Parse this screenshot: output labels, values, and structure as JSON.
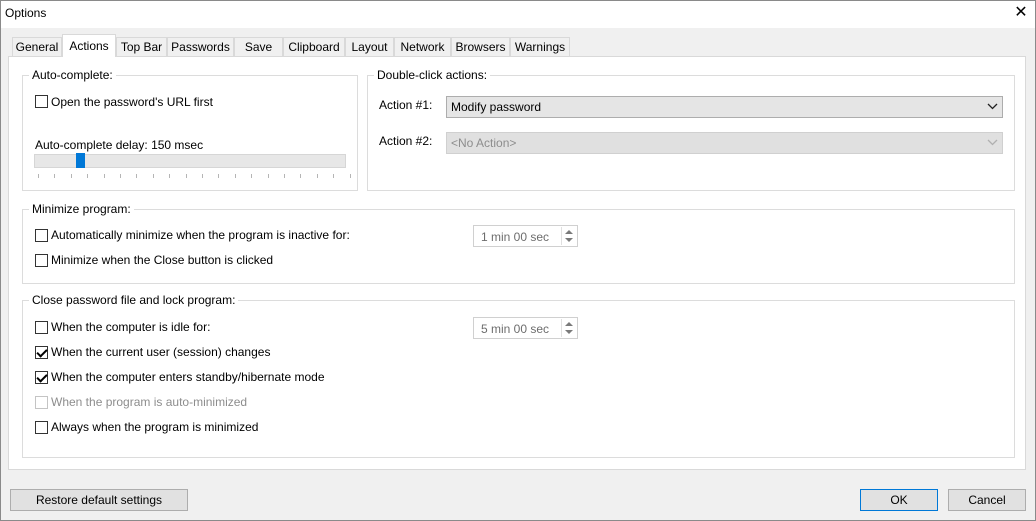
{
  "window": {
    "title": "Options",
    "close_glyph": "✕"
  },
  "tabs": [
    {
      "label": "General",
      "active": false
    },
    {
      "label": "Actions",
      "active": true
    },
    {
      "label": "Top Bar",
      "active": false
    },
    {
      "label": "Passwords",
      "active": false
    },
    {
      "label": "Save",
      "active": false
    },
    {
      "label": "Clipboard",
      "active": false
    },
    {
      "label": "Layout",
      "active": false
    },
    {
      "label": "Network",
      "active": false
    },
    {
      "label": "Browsers",
      "active": false
    },
    {
      "label": "Warnings",
      "active": false
    }
  ],
  "autocomplete": {
    "legend": "Auto-complete:",
    "open_url_label": "Open the password's URL first",
    "open_url_checked": false,
    "delay_label": "Auto-complete delay: 150 msec",
    "delay_fraction": 0.14
  },
  "doubleclick": {
    "legend": "Double-click actions:",
    "action1_label": "Action #1:",
    "action1_value": "Modify password",
    "action2_label": "Action #2:",
    "action2_value": "<No Action>"
  },
  "minimize": {
    "legend": "Minimize program:",
    "auto_label": "Automatically minimize when the program is inactive for:",
    "auto_checked": false,
    "auto_time": "1 min 00 sec",
    "close_label": "Minimize when the Close button is clicked",
    "close_checked": false
  },
  "lock": {
    "legend": "Close password file and lock program:",
    "idle_label": "When the computer is idle for:",
    "idle_checked": false,
    "idle_time": "5 min 00 sec",
    "session_label": "When the current user (session) changes",
    "session_checked": true,
    "standby_label": "When the computer enters standby/hibernate mode",
    "standby_checked": true,
    "autominimized_label": "When the program is auto-minimized",
    "autominimized_checked": false,
    "always_label": "Always when the program is minimized",
    "always_checked": false
  },
  "buttons": {
    "restore": "Restore default settings",
    "ok": "OK",
    "cancel": "Cancel"
  },
  "icons": {
    "combo_arrow": "chevron-down-icon",
    "close": "close-icon"
  },
  "colors": {
    "accent": "#0078d7"
  }
}
